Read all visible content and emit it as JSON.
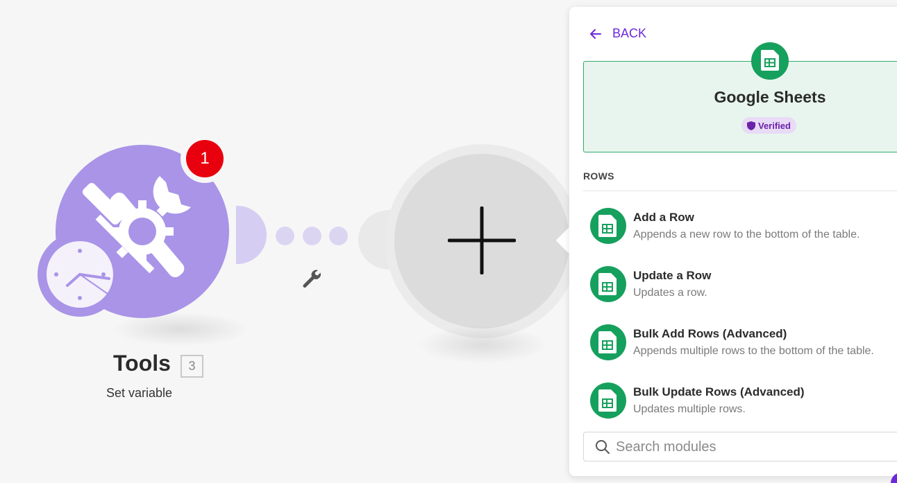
{
  "canvas": {
    "tools_node": {
      "title": "Tools",
      "count": "3",
      "subtitle": "Set variable",
      "notification_count": "1"
    }
  },
  "panel": {
    "back_label": "BACK",
    "app": {
      "name": "Google Sheets",
      "verified_label": "Verified"
    },
    "section_label": "ROWS",
    "modules": [
      {
        "title": "Add a Row",
        "description": "Appends a new row to the bottom of the table."
      },
      {
        "title": "Update a Row",
        "description": "Updates a row."
      },
      {
        "title": "Bulk Add Rows (Advanced)",
        "description": "Appends multiple rows to the bottom of the table."
      },
      {
        "title": "Bulk Update Rows (Advanced)",
        "description": "Updates multiple rows."
      }
    ],
    "search": {
      "placeholder": "Search modules",
      "value": ""
    }
  },
  "colors": {
    "tools_purple": "#a994e8",
    "sheets_green": "#16a05d",
    "accent_purple": "#6d28d9",
    "notify_red": "#e8000f"
  },
  "icons": {
    "tools": "tools-icon",
    "clock": "clock-icon",
    "wrench": "wrench-icon",
    "plus": "plus-icon",
    "back": "arrow-left-icon",
    "sheets": "google-sheets-icon",
    "verified": "shield-icon",
    "search": "search-icon"
  }
}
